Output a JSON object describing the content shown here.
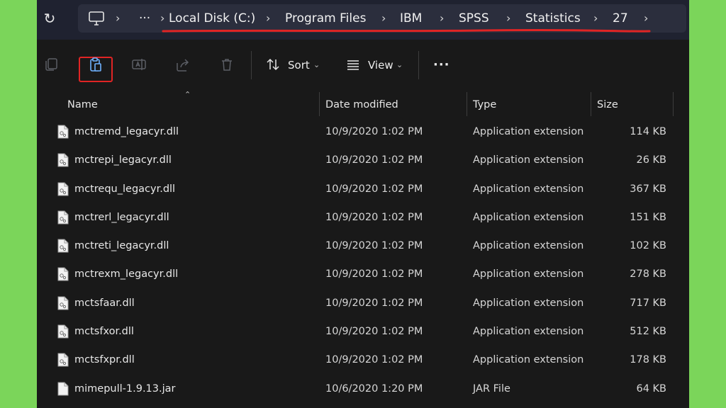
{
  "address_bar": {
    "breadcrumbs": [
      "Local Disk (C:)",
      "Program Files",
      "IBM",
      "SPSS",
      "Statistics",
      "27"
    ],
    "more_label": "···"
  },
  "toolbar": {
    "sort_label": "Sort",
    "view_label": "View",
    "more_label": "···"
  },
  "columns": [
    "Name",
    "Date modified",
    "Type",
    "Size"
  ],
  "files": [
    {
      "name": "mctremd_legacyr.dll",
      "date": "10/9/2020 1:02 PM",
      "type": "Application extension",
      "size": "114 KB"
    },
    {
      "name": "mctrepi_legacyr.dll",
      "date": "10/9/2020 1:02 PM",
      "type": "Application extension",
      "size": "26 KB"
    },
    {
      "name": "mctrequ_legacyr.dll",
      "date": "10/9/2020 1:02 PM",
      "type": "Application extension",
      "size": "367 KB"
    },
    {
      "name": "mctrerl_legacyr.dll",
      "date": "10/9/2020 1:02 PM",
      "type": "Application extension",
      "size": "151 KB"
    },
    {
      "name": "mctreti_legacyr.dll",
      "date": "10/9/2020 1:02 PM",
      "type": "Application extension",
      "size": "102 KB"
    },
    {
      "name": "mctrexm_legacyr.dll",
      "date": "10/9/2020 1:02 PM",
      "type": "Application extension",
      "size": "278 KB"
    },
    {
      "name": "mctsfaar.dll",
      "date": "10/9/2020 1:02 PM",
      "type": "Application extension",
      "size": "717 KB"
    },
    {
      "name": "mctsfxor.dll",
      "date": "10/9/2020 1:02 PM",
      "type": "Application extension",
      "size": "512 KB"
    },
    {
      "name": "mctsfxpr.dll",
      "date": "10/9/2020 1:02 PM",
      "type": "Application extension",
      "size": "178 KB"
    },
    {
      "name": "mimepull-1.9.13.jar",
      "date": "10/6/2020 1:20 PM",
      "type": "JAR File",
      "size": "64 KB"
    }
  ],
  "colors": {
    "background": "#7bd55a",
    "window": "#191919",
    "address_bar": "#2b2e3d",
    "highlight": "#e02424"
  }
}
